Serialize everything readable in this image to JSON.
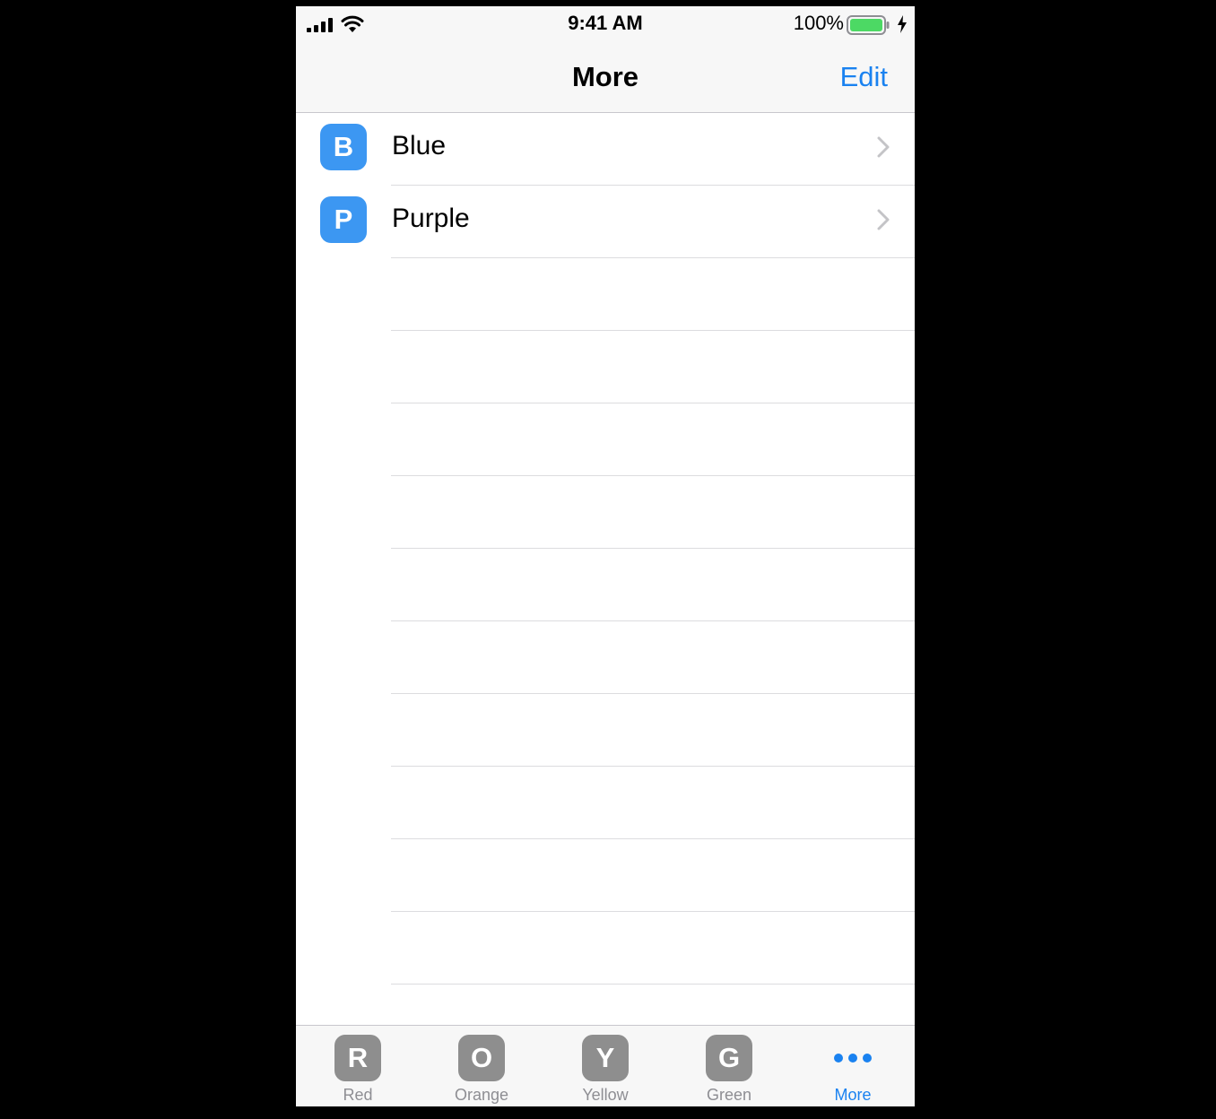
{
  "status_bar": {
    "time": "9:41 AM",
    "battery_percent": "100%",
    "battery_level": 1.0,
    "signal_icon": "cellular-signal-icon",
    "wifi_icon": "wifi-icon",
    "charging_icon": "charging-bolt-icon"
  },
  "nav": {
    "title": "More",
    "edit_label": "Edit"
  },
  "list": {
    "items": [
      {
        "badge": "B",
        "label": "Blue",
        "color": "#3c97f2"
      },
      {
        "badge": "P",
        "label": "Purple",
        "color": "#3c97f2"
      }
    ],
    "empty_rows": 10
  },
  "tabs": [
    {
      "badge": "R",
      "label": "Red",
      "active": false
    },
    {
      "badge": "O",
      "label": "Orange",
      "active": false
    },
    {
      "badge": "Y",
      "label": "Yellow",
      "active": false
    },
    {
      "badge": "G",
      "label": "Green",
      "active": false
    },
    {
      "badge": "",
      "label": "More",
      "active": true,
      "icon": "more-dots-icon"
    }
  ],
  "colors": {
    "accent": "#1a82f0",
    "tab_inactive_badge": "#8e8e8e",
    "battery_fill": "#4cd964"
  }
}
